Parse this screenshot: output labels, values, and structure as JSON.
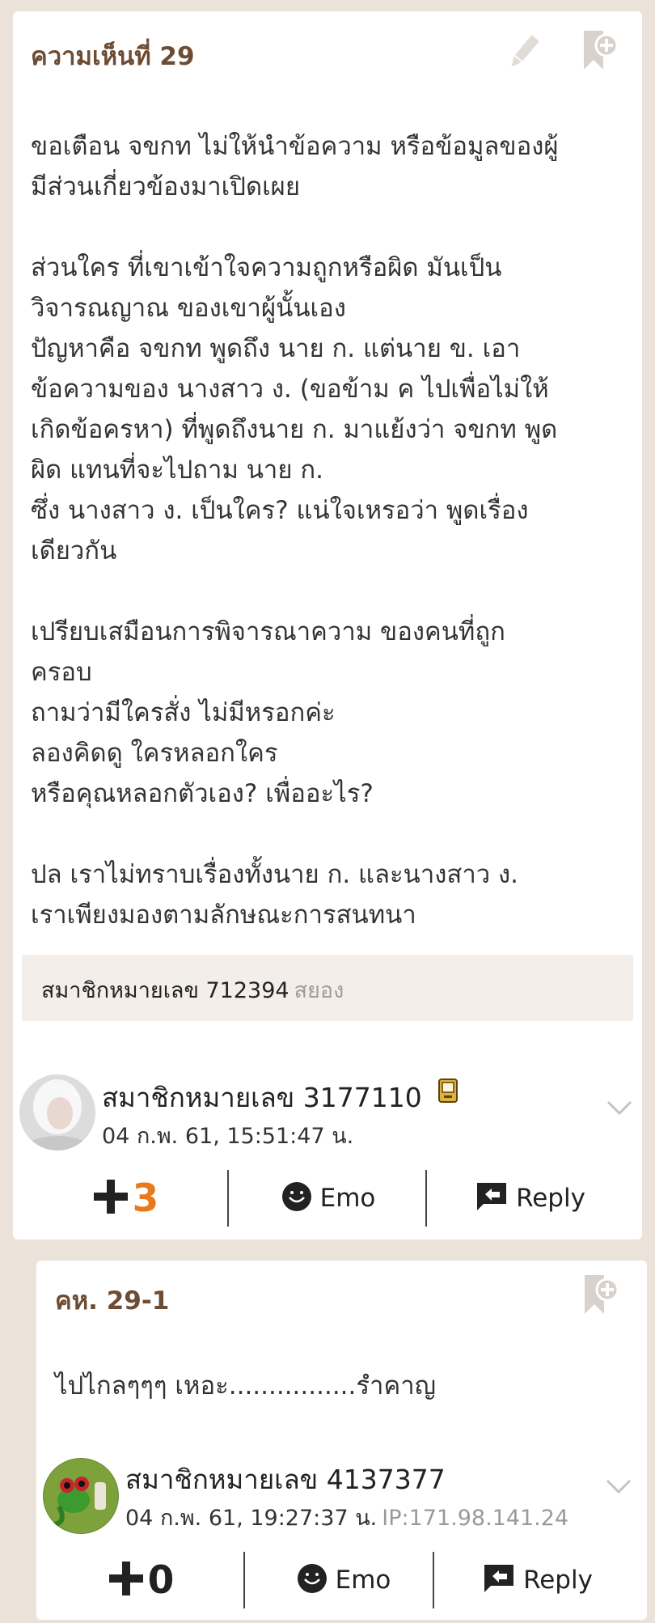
{
  "main": {
    "title": "ความเห็นที่ 29",
    "body": "ขอเตือน จขกท ไม่ให้นำข้อความ หรือข้อมูลของผู้\nมีส่วนเกี่ยวข้องมาเปิดเผย\n\nส่วนใคร ที่เขาเข้าใจความถูกหรือผิด มันเป็น\nวิจารณญาณ ของเขาผู้นั้นเอง\nปัญหาคือ จขกท พูดถึง นาย ก. แต่นาย ข. เอา\nข้อความของ นางสาว ง. (ขอข้าม ค ไปเพื่อไม่ให้\nเกิดข้อครหา) ที่พูดถึงนาย ก. มาแย้งว่า จขกท พูด\nผิด แทนที่จะไปถาม นาย ก.\nซึ่ง นางสาว ง. เป็นใคร? แน่ใจเหรอว่า พูดเรื่อง\nเดียวกัน\n\nเปรียบเสมือนการพิจารณาความ ของคนที่ถูก\nครอบ\nถามว่ามีใครสั่ง ไม่มีหรอกค่ะ\nลองคิดดู ใครหลอกใคร\nหรือคุณหลอกตัวเอง? เพื่ออะไร?\n\nปล เราไม่ทราบเรื่องทั้งนาย ก. และนางสาว ง.\nเราเพียงมองตามลักษณะการสนทนา",
    "quoted_member": {
      "id": "สมาชิกหมายเลข 712394",
      "nickname": "สยอง"
    },
    "author": {
      "name": "สมาชิกหมายเลข 3177110",
      "date": "04 ก.พ. 61, 15:51:47 น."
    },
    "actions": {
      "plus_count": "3",
      "emo_label": "Emo",
      "reply_label": "Reply"
    },
    "colors": {
      "plus_count": "#e8791d"
    }
  },
  "reply": {
    "title": "คห. 29-1",
    "body": "ไปไกลๆๆๆ เหอะ................รำคาญ",
    "author": {
      "name": "สมาชิกหมายเลข 4137377",
      "date": "04 ก.พ. 61, 19:27:37 น.",
      "ip": "IP:171.98.141.24"
    },
    "actions": {
      "plus_count": "0",
      "emo_label": "Emo",
      "reply_label": "Reply"
    },
    "colors": {
      "plus_count": "#222222"
    }
  },
  "icons": [
    "edit-pencil-icon",
    "bookmark-plus-icon",
    "chevron-down-icon",
    "plus-icon",
    "emo-smiley-icon",
    "reply-arrow-icon",
    "phone-badge-icon"
  ]
}
